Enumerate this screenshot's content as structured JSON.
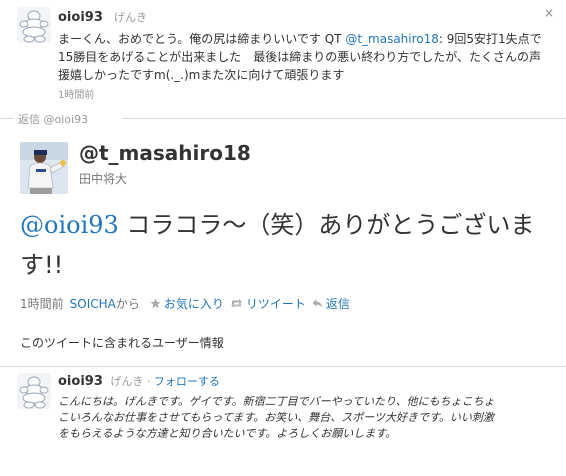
{
  "top_tweet": {
    "username": "oioi93",
    "fullname": "げんき",
    "text_before": "まーくん、おめでとう。俺の尻は締まりいいです QT ",
    "mention": "@t_masahiro18",
    "text_after": ": 9回5安打1失点で15勝目をあげることが出来ました　最後は締まりの悪い終わり方でしたが、たくさんの声援嬉しかったですm(._.)mまた次に向けて頑張ります",
    "time": "1時間前",
    "close_icon": "×"
  },
  "reply_separator": "返信 @oioi93",
  "main_tweet": {
    "handle": "@t_masahiro18",
    "display_name": "田中将大",
    "mention": "@oioi93",
    "text": " コラコラ～（笑）ありがとうございます!!",
    "time": "1時間前",
    "source": "SOICHA",
    "source_suffix": "から",
    "favorite": "お気に入り",
    "retweet": "リツイート",
    "reply": "返信"
  },
  "user_info": {
    "title": "このツイートに含まれるユーザー情報",
    "username": "oioi93",
    "fullname": "げんき",
    "follow": "フォローする",
    "bio": "こんにちは。げんきです。ゲイです。新宿二丁目でバーやっていたり、他にもちょこちょこいろんなお仕事をさせてもらってます。お笑い、舞台、スポーツ大好きです。いい刺激をもらえるような方達と知り合いたいです。よろしくお願いします。"
  },
  "colors": {
    "link": "#2276bb",
    "text": "#333333",
    "muted": "#999999"
  }
}
